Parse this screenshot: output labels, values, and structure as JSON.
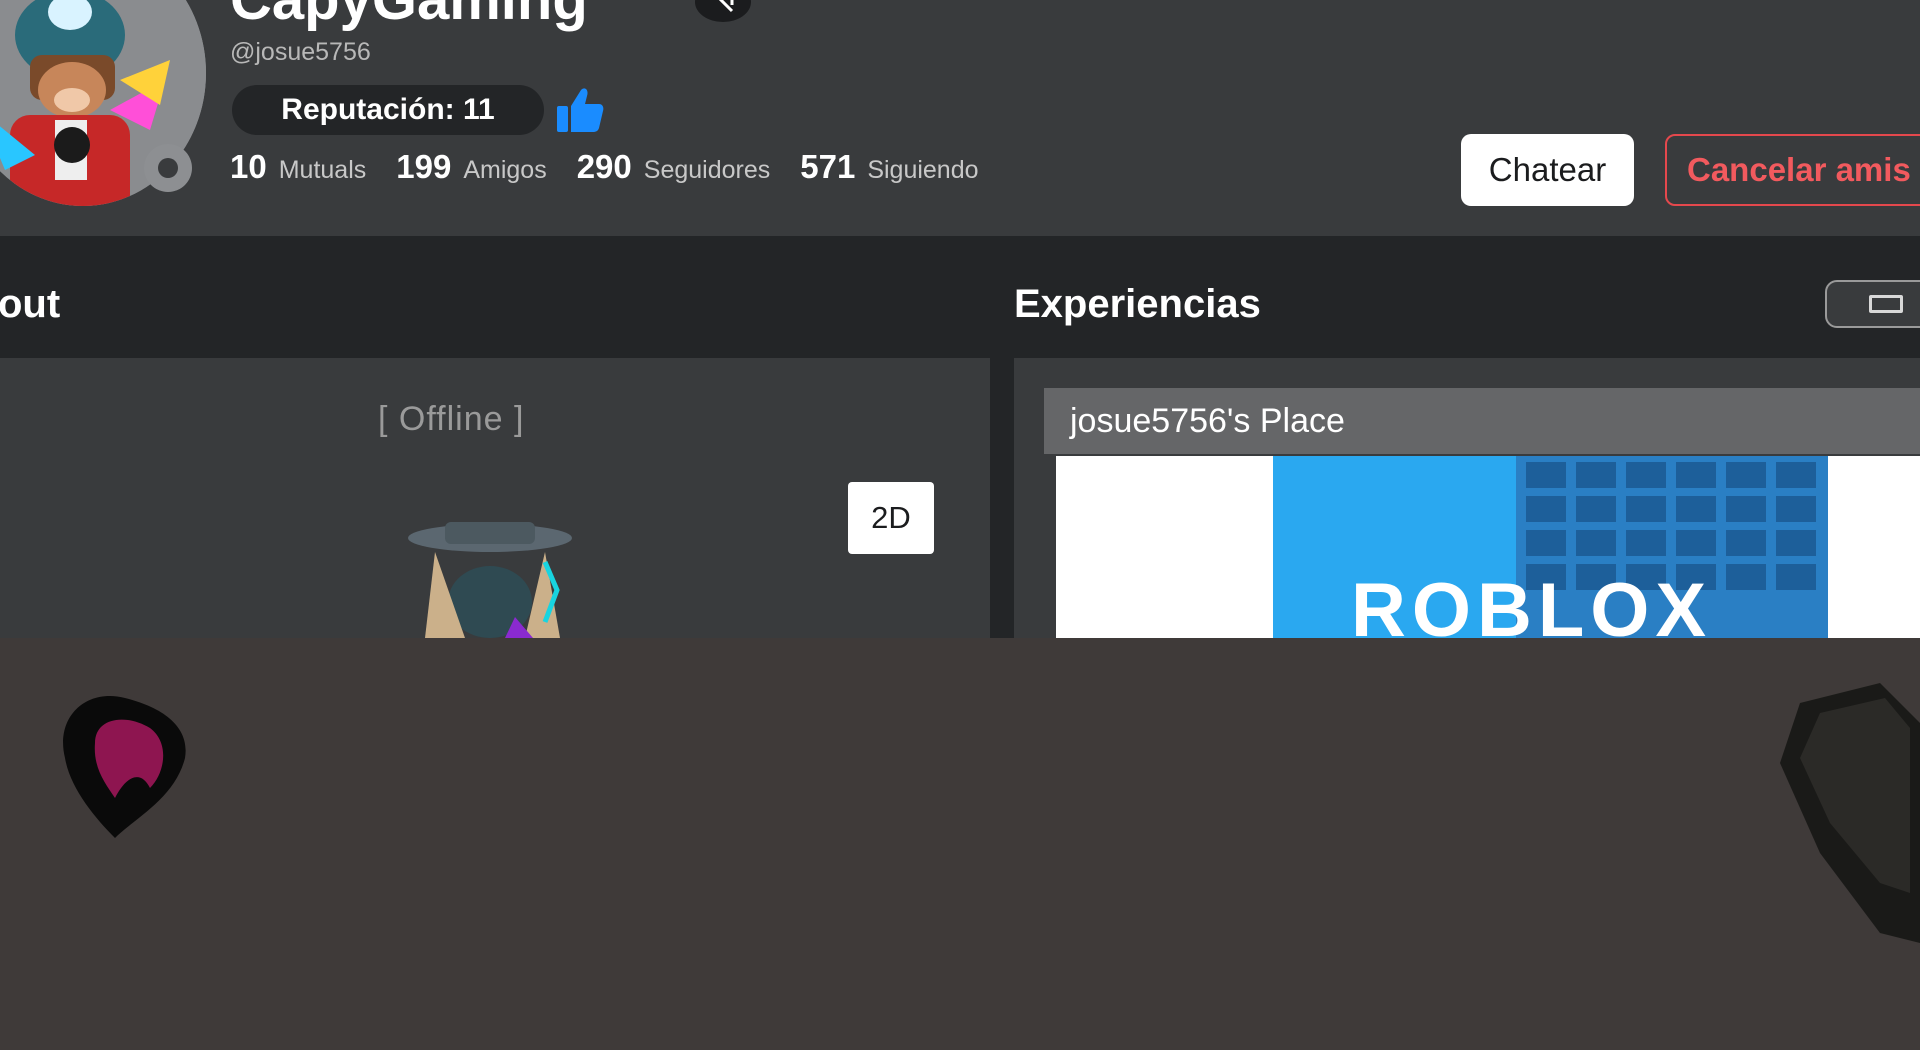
{
  "profile": {
    "display_name": "CapyGaming",
    "username": "@josue5756",
    "reputation": "Reputación: 11",
    "stats": [
      {
        "value": "10",
        "label": "Mutuals"
      },
      {
        "value": "199",
        "label": "Amigos"
      },
      {
        "value": "290",
        "label": "Seguidores"
      },
      {
        "value": "571",
        "label": "Siguiendo"
      }
    ],
    "actions": {
      "chat": "Chatear",
      "cancel": "Cancelar amis"
    }
  },
  "about": {
    "title": "out",
    "status": "[ Offline ]",
    "view_toggle": "2D"
  },
  "experiences": {
    "title": "Experiencias",
    "place_name": "josue5756's Place",
    "thumbnail_text": "ROBLOX"
  },
  "colors": {
    "header_bg": "#393b3d",
    "page_bg": "#232527",
    "danger": "#e5484d",
    "thumb_blue": "#1a8cff",
    "lower_bg": "#3f3a39"
  }
}
